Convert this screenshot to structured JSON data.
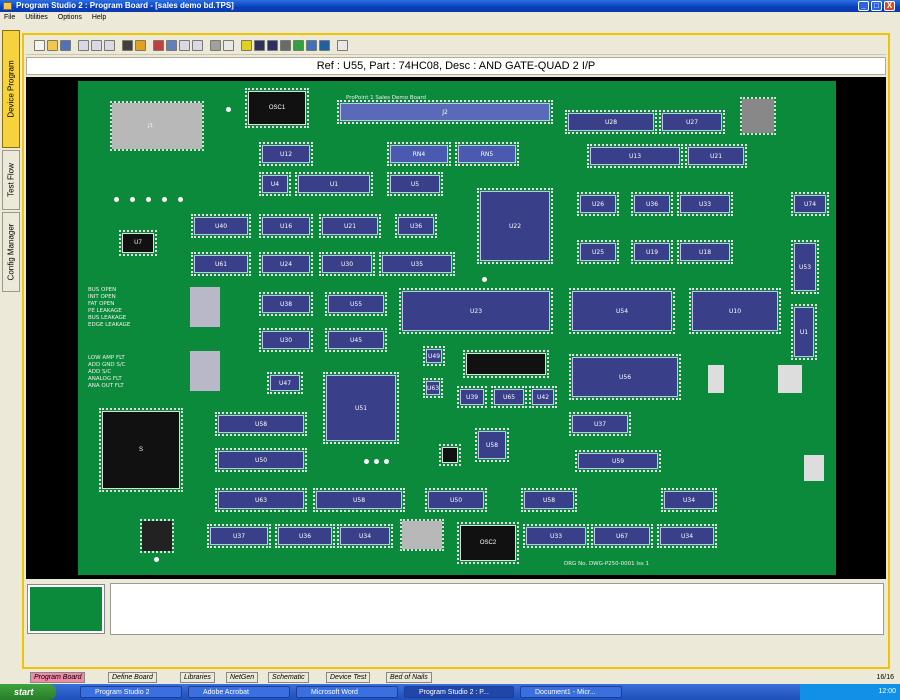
{
  "window": {
    "title": "Program Studio 2 : Program Board - [sales demo bd.TPS]",
    "min_label": "_",
    "max_label": "□",
    "close_label": "X"
  },
  "menu": [
    "File",
    "Utilities",
    "Options",
    "Help"
  ],
  "left_tabs": [
    "Device Program",
    "Test Flow",
    "Config Manager"
  ],
  "info_bar": "Ref : U55,  Part : 74HC08, Desc : AND GATE-QUAD 2 I/P",
  "board": {
    "header_label": "ProPoint 1 Sales Demo Board",
    "dwg_number": "DRG No. DWG-P250-0001 Iss 1",
    "left_labels_1": [
      "BUS OPEN",
      "INIT OPEN",
      "FAT OPEN",
      "PE LEAKAGE",
      "BUS LEAKAGE",
      "EDGE LEAKAGE"
    ],
    "left_labels_2": [
      "LOW AMP FLT",
      "ADD GND S/C",
      "ADD S/C",
      "ANALOG FLT",
      "ANA OUT FLT"
    ],
    "chips": [
      "J2",
      "OSC1",
      "U12",
      "U4",
      "U1",
      "U5",
      "RN4",
      "RN5",
      "U28",
      "U27",
      "U13",
      "U21",
      "U22",
      "U26",
      "U40",
      "U16",
      "U21",
      "U36",
      "U61",
      "U24",
      "U30",
      "U35",
      "U38",
      "U14",
      "U17",
      "U18",
      "U19",
      "U25",
      "U33",
      "U53",
      "U30",
      "U74",
      "U52",
      "U55",
      "U45",
      "U23",
      "U1",
      "U54",
      "U10",
      "U47",
      "U49",
      "U39",
      "U65",
      "U31",
      "U42",
      "U60",
      "U27",
      "U56",
      "U58",
      "U63",
      "U59",
      "U58",
      "U50",
      "U51",
      "U58",
      "U37",
      "U36",
      "U34",
      "U33",
      "U67",
      "OSC2",
      "S",
      "U7"
    ]
  },
  "bottom_tabs": [
    "Program Board",
    "Define Board",
    "Libraries",
    "NetGen",
    "Schematic",
    "Device Test",
    "Bed of Nails"
  ],
  "zoom_label": "16/16",
  "taskbar": {
    "start_label": "start",
    "tasks": [
      "Program Studio 2",
      "Adobe Acrobat",
      "Microsoft Word",
      "Program Studio 2 : P...",
      "Document1 - Micr..."
    ],
    "clock": "12:00"
  }
}
